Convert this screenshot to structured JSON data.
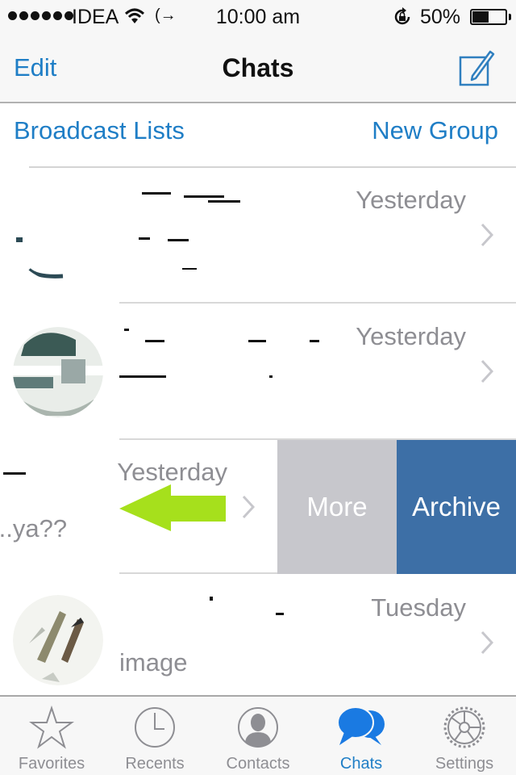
{
  "status_bar": {
    "carrier": "IDEA",
    "signal_bars": 6,
    "time": "10:00 am",
    "battery_percent": "50%",
    "battery_level": 0.5,
    "icons": [
      "signal-dots-icon",
      "wifi-icon",
      "call-forward-icon",
      "rotation-lock-icon",
      "battery-icon"
    ]
  },
  "nav_bar": {
    "edit_label": "Edit",
    "title": "Chats",
    "compose_icon": "compose-icon"
  },
  "action_bar": {
    "broadcast_label": "Broadcast Lists",
    "new_group_label": "New Group"
  },
  "chats": [
    {
      "name": "",
      "time": "Yesterday",
      "preview": "",
      "redacted": true
    },
    {
      "name": "",
      "time": "Yesterday",
      "preview": "",
      "redacted": true
    },
    {
      "name": "",
      "time": "Yesterday",
      "preview": "...ya??",
      "redacted": true,
      "swiped": true
    },
    {
      "name": "",
      "time": "Tuesday",
      "preview": "image",
      "redacted": true
    }
  ],
  "swipe_actions": {
    "more_label": "More",
    "archive_label": "Archive"
  },
  "annotation": {
    "arrow_direction": "left",
    "color": "#a6e01c"
  },
  "tab_bar": {
    "active": "Chats",
    "tabs": [
      {
        "label": "Favorites",
        "icon": "star-icon"
      },
      {
        "label": "Recents",
        "icon": "clock-icon"
      },
      {
        "label": "Contacts",
        "icon": "contact-icon"
      },
      {
        "label": "Chats",
        "icon": "chat-bubbles-icon"
      },
      {
        "label": "Settings",
        "icon": "gear-icon"
      }
    ]
  },
  "colors": {
    "accent": "#1f7ec6",
    "archive": "#3d6fa6",
    "more": "#c7c7cc",
    "secondary_text": "#8e8e93"
  }
}
